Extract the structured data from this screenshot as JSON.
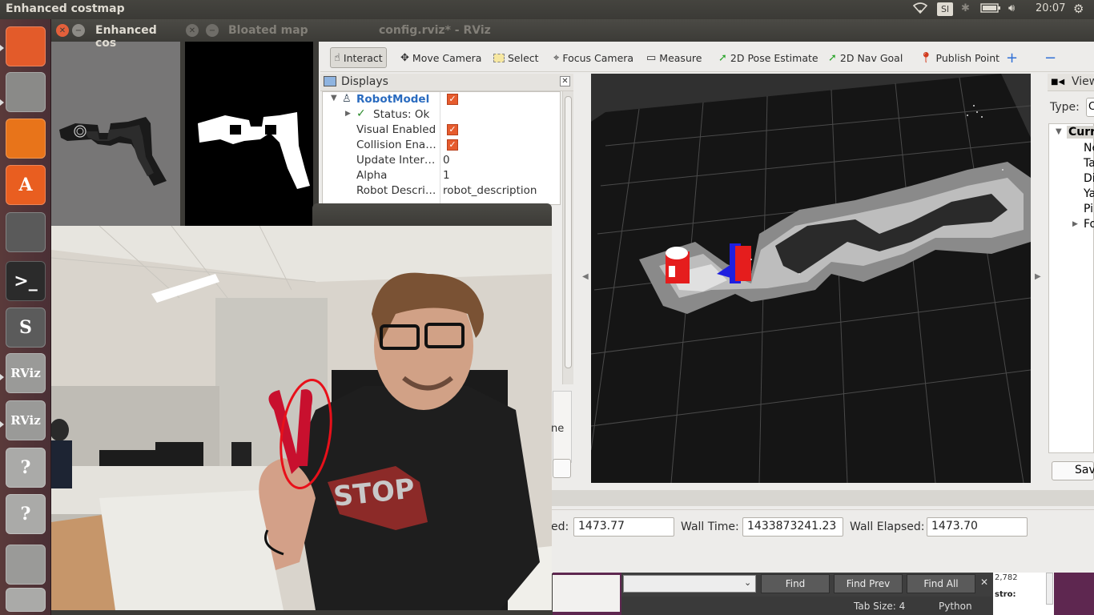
{
  "top_panel": {
    "title": "Enhanced costmap",
    "keyboard": "Sl",
    "time": "20:07"
  },
  "launcher": {
    "items": [
      {
        "icon": "ubuntu-logo-icon",
        "label": ""
      },
      {
        "icon": "files-icon",
        "label": ""
      },
      {
        "icon": "firefox-icon",
        "label": ""
      },
      {
        "icon": "software-center-icon",
        "label": "A"
      },
      {
        "icon": "system-settings-icon",
        "label": ""
      },
      {
        "icon": "terminal-icon",
        "label": ">_"
      },
      {
        "icon": "sublime-text-icon",
        "label": "S"
      },
      {
        "icon": "rviz-icon",
        "label": "RViz"
      },
      {
        "icon": "rviz-icon",
        "label": "RViz"
      },
      {
        "icon": "unknown-app-icon",
        "label": "?"
      },
      {
        "icon": "unknown-app-icon",
        "label": "?"
      },
      {
        "icon": "drive-icon",
        "label": ""
      },
      {
        "icon": "trash-icon",
        "label": ""
      }
    ]
  },
  "windows": {
    "costmap_title": "Enhanced cos",
    "bloated_title": "Bloated map",
    "rviz_title": "config.rviz* - RViz"
  },
  "toolbar": {
    "interact": "Interact",
    "move_camera": "Move Camera",
    "select": "Select",
    "focus_camera": "Focus Camera",
    "measure": "Measure",
    "pose_estimate": "2D Pose Estimate",
    "nav_goal": "2D Nav Goal",
    "publish_point": "Publish Point",
    "add": "+",
    "remove": "−"
  },
  "displays": {
    "title": "Displays",
    "rows": [
      {
        "name": "RobotModel",
        "value": ""
      },
      {
        "name": "Status: Ok",
        "value": ""
      },
      {
        "name": "Visual Enabled",
        "value": ""
      },
      {
        "name": "Collision Ena…",
        "value": ""
      },
      {
        "name": "Update Inter…",
        "value": "0"
      },
      {
        "name": "Alpha",
        "value": "1"
      },
      {
        "name": "Robot Descri…",
        "value": "robot_description"
      }
    ]
  },
  "views": {
    "title": "View",
    "type_label": "Type:",
    "type_value": "C",
    "current": "Curre",
    "items": [
      "Ne",
      "Ta",
      "Di",
      "Ya",
      "Pi",
      "Fo"
    ],
    "save": "Sav"
  },
  "time": {
    "ros_elapsed_label": "ed:",
    "ros_elapsed": "1473.77",
    "wall_time_label": "Wall Time:",
    "wall_time": "1433873241.23",
    "wall_elapsed_label": "Wall Elapsed:",
    "wall_elapsed": "1473.70"
  },
  "partial": {
    "ne": "ne"
  },
  "editor": {
    "find": "Find",
    "find_prev": "Find Prev",
    "find_all": "Find All",
    "tab_size": "Tab Size: 4",
    "syntax": "Python",
    "count": "2,782",
    "side_text": "stro:"
  },
  "camera": {
    "shirt_text": "STOP"
  }
}
